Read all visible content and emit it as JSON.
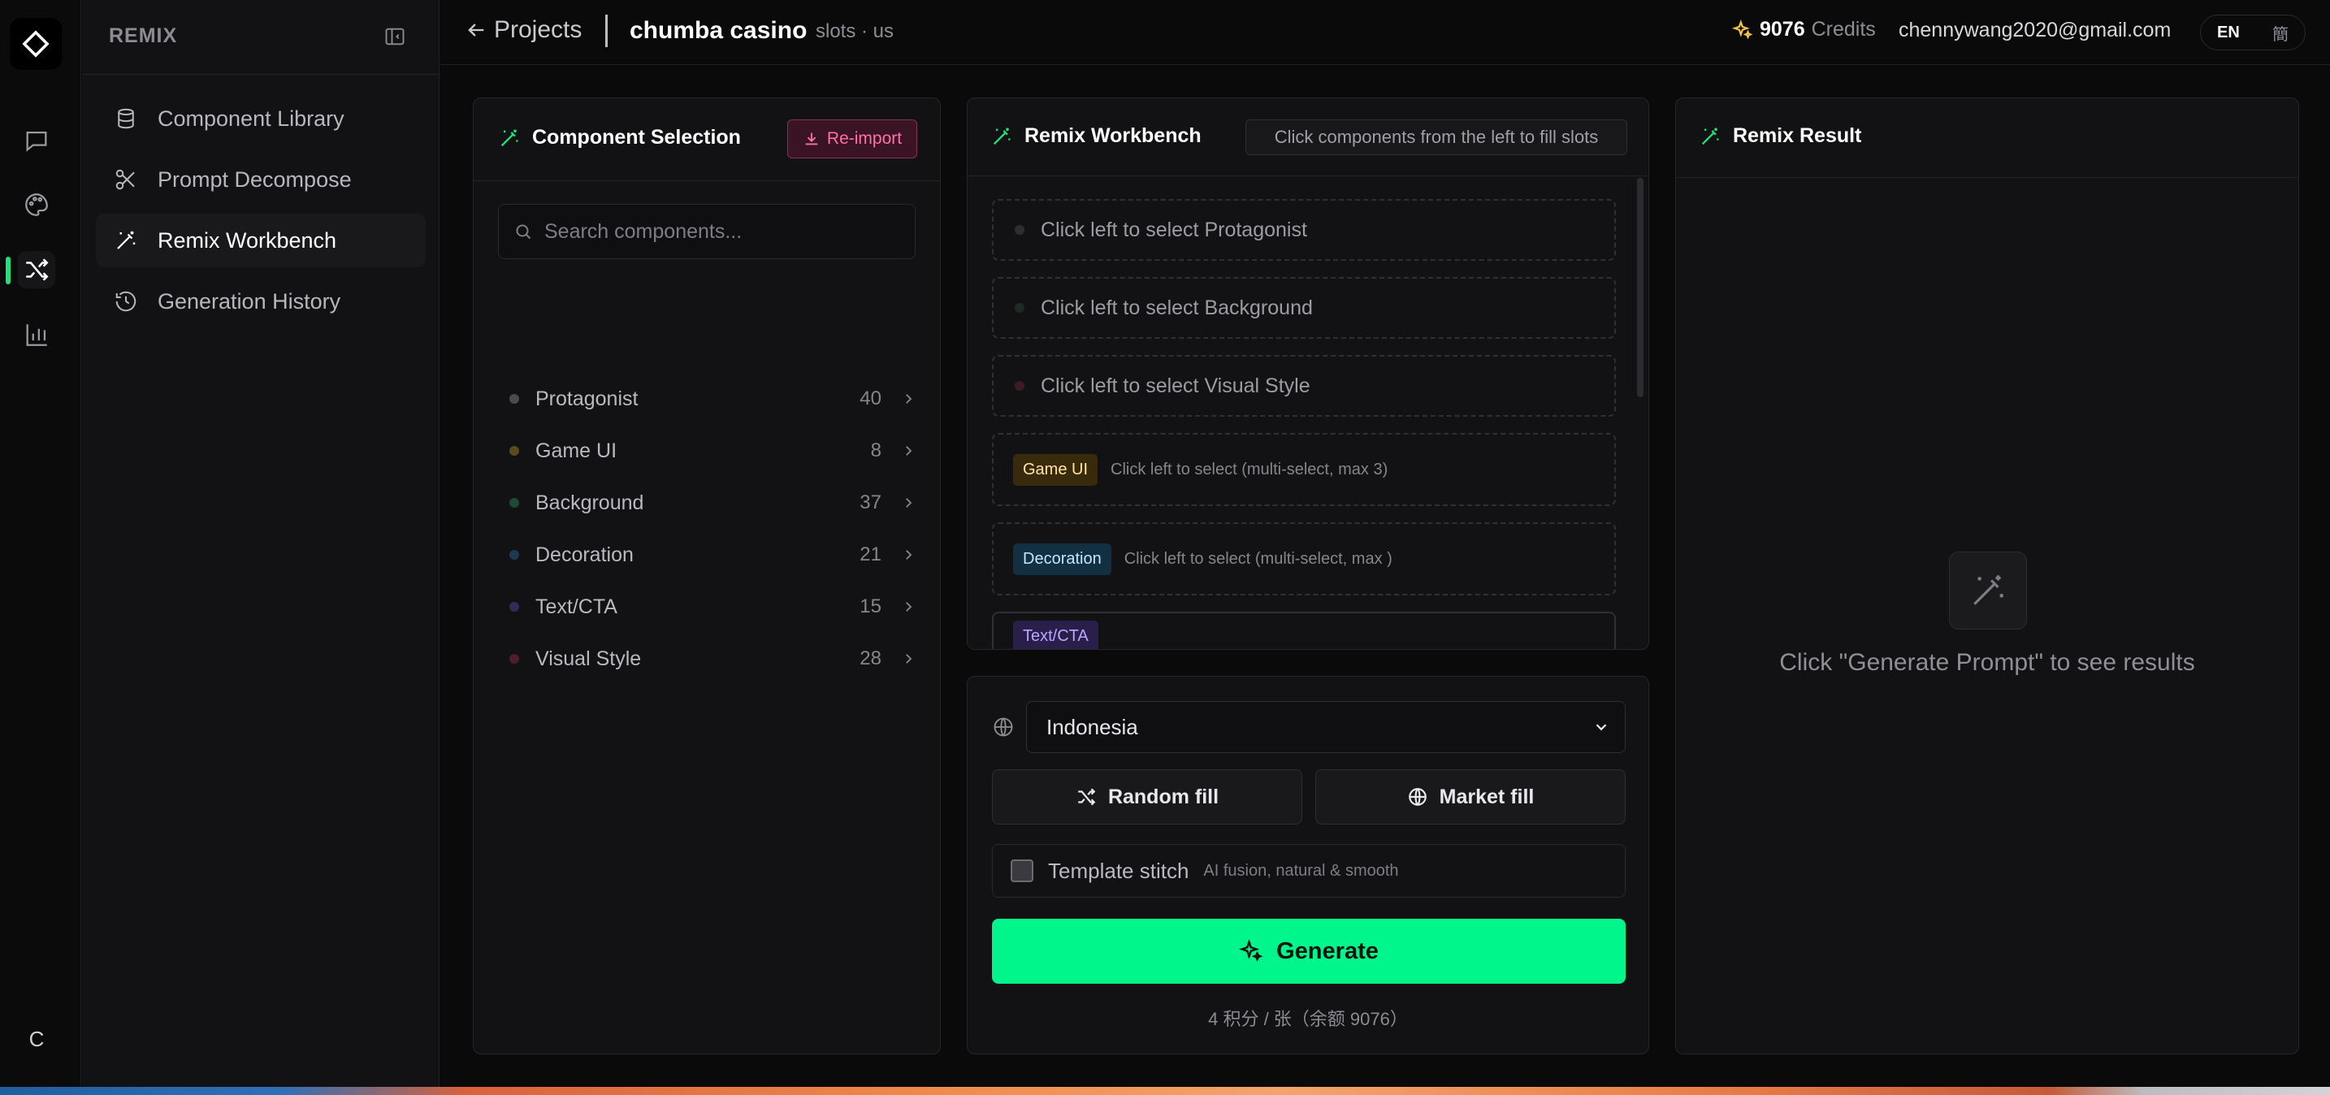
{
  "sidebar": {
    "brand": "REMIX",
    "user_initial": "C",
    "items": [
      {
        "label": "Component Library",
        "icon": "database-icon"
      },
      {
        "label": "Prompt Decompose",
        "icon": "scissors-icon"
      },
      {
        "label": "Remix Workbench",
        "icon": "magic-wand-icon",
        "active": true
      },
      {
        "label": "Generation History",
        "icon": "history-icon"
      }
    ]
  },
  "header": {
    "back_label": "Projects",
    "project_name": "chumba casino",
    "project_meta": "slots · us",
    "credits_value": "9076",
    "credits_label": "Credits",
    "email": "chennywang2020@gmail.com",
    "lang_en": "EN",
    "lang_zh": "簡"
  },
  "selection": {
    "title": "Component Selection",
    "reimport_label": "Re-import",
    "search_placeholder": "Search components...",
    "categories": [
      {
        "name": "Protagonist",
        "count": "40",
        "color": "#4a4a4f"
      },
      {
        "name": "Game UI",
        "count": "8",
        "color": "#5a4a1e"
      },
      {
        "name": "Background",
        "count": "37",
        "color": "#1d4a34"
      },
      {
        "name": "Decoration",
        "count": "21",
        "color": "#1e3a4e"
      },
      {
        "name": "Text/CTA",
        "count": "15",
        "color": "#352a55"
      },
      {
        "name": "Visual Style",
        "count": "28",
        "color": "#4e1e2a"
      }
    ]
  },
  "workbench": {
    "title": "Remix Workbench",
    "hint": "Click components from the left to fill slots",
    "slots": [
      {
        "text": "Click left to select Protagonist"
      },
      {
        "text": "Click left to select Background"
      },
      {
        "text": "Click left to select Visual Style"
      }
    ],
    "multi_slots": [
      {
        "tag": "Game UI",
        "text": "Click left to select (multi-select, max 3)"
      },
      {
        "tag": "Decoration",
        "text": "Click left to select (multi-select, max )"
      },
      {
        "tag": "Text/CTA",
        "text": ""
      }
    ]
  },
  "controls": {
    "market": "Indonesia",
    "random_fill": "Random fill",
    "market_fill": "Market fill",
    "template_stitch": "Template stitch",
    "template_hint": "AI fusion, natural & smooth",
    "generate": "Generate",
    "cost": "4 积分 / 张（余额 9076）"
  },
  "result": {
    "title": "Remix Result",
    "empty": "Click \"Generate Prompt\" to see results"
  },
  "colors": {
    "accent": "#00f58a",
    "reimport": "#ff6fa8",
    "credits_icon": "#f3c34a"
  }
}
